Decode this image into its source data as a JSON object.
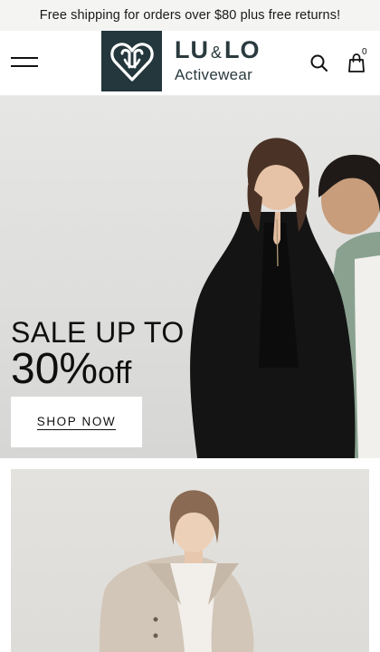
{
  "announcement": {
    "text": "Free shipping for orders over $80 plus free returns!"
  },
  "header": {
    "menu_icon": "hamburger-menu-icon",
    "brand": {
      "name_part1": "LU",
      "ampersand": "&",
      "name_part2": "LO",
      "tagline": "Activewear",
      "mark_color": "#23373c"
    },
    "search_icon": "search-icon",
    "cart_icon": "shopping-bag-icon",
    "cart_count": "0"
  },
  "hero": {
    "sale_text": "SALE UP TO",
    "percent": "30%",
    "off_text": "off",
    "cta_label": "SHOP NOW",
    "image": "two-models-in-black-blazer-and-green-jacket"
  },
  "promo_card": {
    "image": "model-in-beige-wool-coat"
  },
  "colors": {
    "text": "#111111",
    "announcement_bg": "#f4f4f2",
    "brand": "#23373c"
  }
}
